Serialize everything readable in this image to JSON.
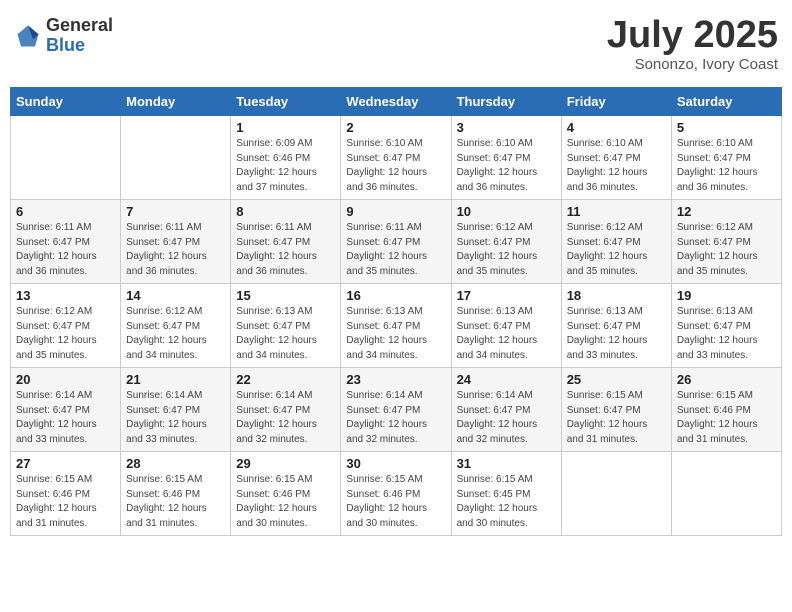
{
  "logo": {
    "general": "General",
    "blue": "Blue"
  },
  "title": {
    "month_year": "July 2025",
    "location": "Sononzo, Ivory Coast"
  },
  "days_of_week": [
    "Sunday",
    "Monday",
    "Tuesday",
    "Wednesday",
    "Thursday",
    "Friday",
    "Saturday"
  ],
  "weeks": [
    [
      {
        "day": "",
        "info": ""
      },
      {
        "day": "",
        "info": ""
      },
      {
        "day": "1",
        "info": "Sunrise: 6:09 AM\nSunset: 6:46 PM\nDaylight: 12 hours\nand 37 minutes."
      },
      {
        "day": "2",
        "info": "Sunrise: 6:10 AM\nSunset: 6:47 PM\nDaylight: 12 hours\nand 36 minutes."
      },
      {
        "day": "3",
        "info": "Sunrise: 6:10 AM\nSunset: 6:47 PM\nDaylight: 12 hours\nand 36 minutes."
      },
      {
        "day": "4",
        "info": "Sunrise: 6:10 AM\nSunset: 6:47 PM\nDaylight: 12 hours\nand 36 minutes."
      },
      {
        "day": "5",
        "info": "Sunrise: 6:10 AM\nSunset: 6:47 PM\nDaylight: 12 hours\nand 36 minutes."
      }
    ],
    [
      {
        "day": "6",
        "info": "Sunrise: 6:11 AM\nSunset: 6:47 PM\nDaylight: 12 hours\nand 36 minutes."
      },
      {
        "day": "7",
        "info": "Sunrise: 6:11 AM\nSunset: 6:47 PM\nDaylight: 12 hours\nand 36 minutes."
      },
      {
        "day": "8",
        "info": "Sunrise: 6:11 AM\nSunset: 6:47 PM\nDaylight: 12 hours\nand 36 minutes."
      },
      {
        "day": "9",
        "info": "Sunrise: 6:11 AM\nSunset: 6:47 PM\nDaylight: 12 hours\nand 35 minutes."
      },
      {
        "day": "10",
        "info": "Sunrise: 6:12 AM\nSunset: 6:47 PM\nDaylight: 12 hours\nand 35 minutes."
      },
      {
        "day": "11",
        "info": "Sunrise: 6:12 AM\nSunset: 6:47 PM\nDaylight: 12 hours\nand 35 minutes."
      },
      {
        "day": "12",
        "info": "Sunrise: 6:12 AM\nSunset: 6:47 PM\nDaylight: 12 hours\nand 35 minutes."
      }
    ],
    [
      {
        "day": "13",
        "info": "Sunrise: 6:12 AM\nSunset: 6:47 PM\nDaylight: 12 hours\nand 35 minutes."
      },
      {
        "day": "14",
        "info": "Sunrise: 6:12 AM\nSunset: 6:47 PM\nDaylight: 12 hours\nand 34 minutes."
      },
      {
        "day": "15",
        "info": "Sunrise: 6:13 AM\nSunset: 6:47 PM\nDaylight: 12 hours\nand 34 minutes."
      },
      {
        "day": "16",
        "info": "Sunrise: 6:13 AM\nSunset: 6:47 PM\nDaylight: 12 hours\nand 34 minutes."
      },
      {
        "day": "17",
        "info": "Sunrise: 6:13 AM\nSunset: 6:47 PM\nDaylight: 12 hours\nand 34 minutes."
      },
      {
        "day": "18",
        "info": "Sunrise: 6:13 AM\nSunset: 6:47 PM\nDaylight: 12 hours\nand 33 minutes."
      },
      {
        "day": "19",
        "info": "Sunrise: 6:13 AM\nSunset: 6:47 PM\nDaylight: 12 hours\nand 33 minutes."
      }
    ],
    [
      {
        "day": "20",
        "info": "Sunrise: 6:14 AM\nSunset: 6:47 PM\nDaylight: 12 hours\nand 33 minutes."
      },
      {
        "day": "21",
        "info": "Sunrise: 6:14 AM\nSunset: 6:47 PM\nDaylight: 12 hours\nand 33 minutes."
      },
      {
        "day": "22",
        "info": "Sunrise: 6:14 AM\nSunset: 6:47 PM\nDaylight: 12 hours\nand 32 minutes."
      },
      {
        "day": "23",
        "info": "Sunrise: 6:14 AM\nSunset: 6:47 PM\nDaylight: 12 hours\nand 32 minutes."
      },
      {
        "day": "24",
        "info": "Sunrise: 6:14 AM\nSunset: 6:47 PM\nDaylight: 12 hours\nand 32 minutes."
      },
      {
        "day": "25",
        "info": "Sunrise: 6:15 AM\nSunset: 6:47 PM\nDaylight: 12 hours\nand 31 minutes."
      },
      {
        "day": "26",
        "info": "Sunrise: 6:15 AM\nSunset: 6:46 PM\nDaylight: 12 hours\nand 31 minutes."
      }
    ],
    [
      {
        "day": "27",
        "info": "Sunrise: 6:15 AM\nSunset: 6:46 PM\nDaylight: 12 hours\nand 31 minutes."
      },
      {
        "day": "28",
        "info": "Sunrise: 6:15 AM\nSunset: 6:46 PM\nDaylight: 12 hours\nand 31 minutes."
      },
      {
        "day": "29",
        "info": "Sunrise: 6:15 AM\nSunset: 6:46 PM\nDaylight: 12 hours\nand 30 minutes."
      },
      {
        "day": "30",
        "info": "Sunrise: 6:15 AM\nSunset: 6:46 PM\nDaylight: 12 hours\nand 30 minutes."
      },
      {
        "day": "31",
        "info": "Sunrise: 6:15 AM\nSunset: 6:45 PM\nDaylight: 12 hours\nand 30 minutes."
      },
      {
        "day": "",
        "info": ""
      },
      {
        "day": "",
        "info": ""
      }
    ]
  ]
}
